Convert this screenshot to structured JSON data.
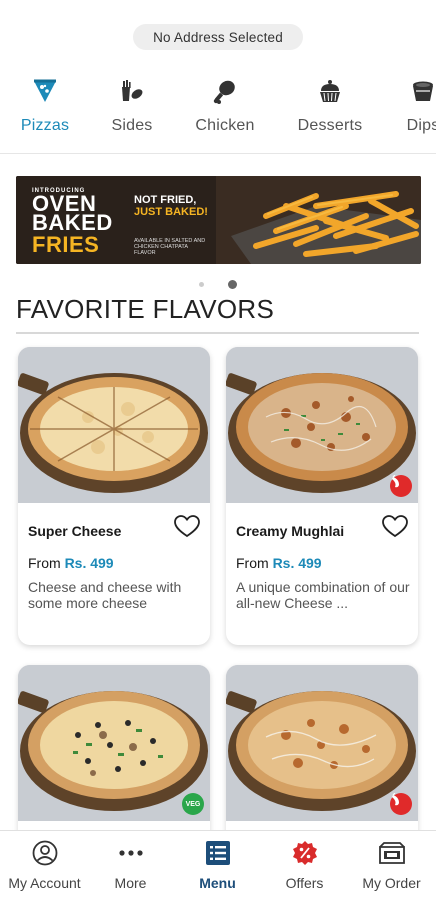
{
  "header": {
    "address_label": "No Address Selected"
  },
  "categories": [
    {
      "label": "Pizzas",
      "icon": "pizza-icon",
      "active": true
    },
    {
      "label": "Sides",
      "icon": "sides-icon",
      "active": false
    },
    {
      "label": "Chicken",
      "icon": "chicken-leg-icon",
      "active": false
    },
    {
      "label": "Desserts",
      "icon": "dessert-icon",
      "active": false
    },
    {
      "label": "Dips",
      "icon": "dip-cup-icon",
      "active": false
    }
  ],
  "banner": {
    "kicker": "INTRODUCING",
    "title_line1": "OVEN",
    "title_line2": "BAKED",
    "title_line3": "FRIES",
    "tag_line1": "NOT FRIED,",
    "tag_line2": "JUST BAKED!",
    "fine_print": "AVAILABLE IN SALTED AND CHICKEN CHATPATA FLAVOR"
  },
  "carousel": {
    "total": 2,
    "active_index": 1
  },
  "section": {
    "title": "FAVORITE FLAVORS"
  },
  "products": [
    {
      "name": "Super Cheese",
      "price_prefix": "From",
      "price": "Rs. 499",
      "description": "Cheese and cheese with some more cheese",
      "badge": "",
      "badge_type": "none"
    },
    {
      "name": "Creamy Mughlai",
      "price_prefix": "From",
      "price": "Rs. 499",
      "description": "A unique combination of our all-new Cheese ...",
      "badge": "",
      "badge_type": "spicy"
    },
    {
      "name": "",
      "price_prefix": "",
      "price": "",
      "description": "",
      "badge": "VEG",
      "badge_type": "veg"
    },
    {
      "name": "",
      "price_prefix": "",
      "price": "",
      "description": "",
      "badge": "",
      "badge_type": "spicy"
    }
  ],
  "bottom_nav": [
    {
      "label": "My Account",
      "icon": "account-icon",
      "active": false
    },
    {
      "label": "More",
      "icon": "more-dots-icon",
      "active": false
    },
    {
      "label": "Menu",
      "icon": "menu-list-icon",
      "active": true
    },
    {
      "label": "Offers",
      "icon": "offers-badge-icon",
      "active": false
    },
    {
      "label": "My Order",
      "icon": "order-box-icon",
      "active": false
    }
  ],
  "colors": {
    "accent": "#1d8ab8",
    "menu_active": "#1d4e7a",
    "spicy": "#e02a2a",
    "veg": "#2aa64a",
    "fries_yellow": "#f6b523"
  }
}
